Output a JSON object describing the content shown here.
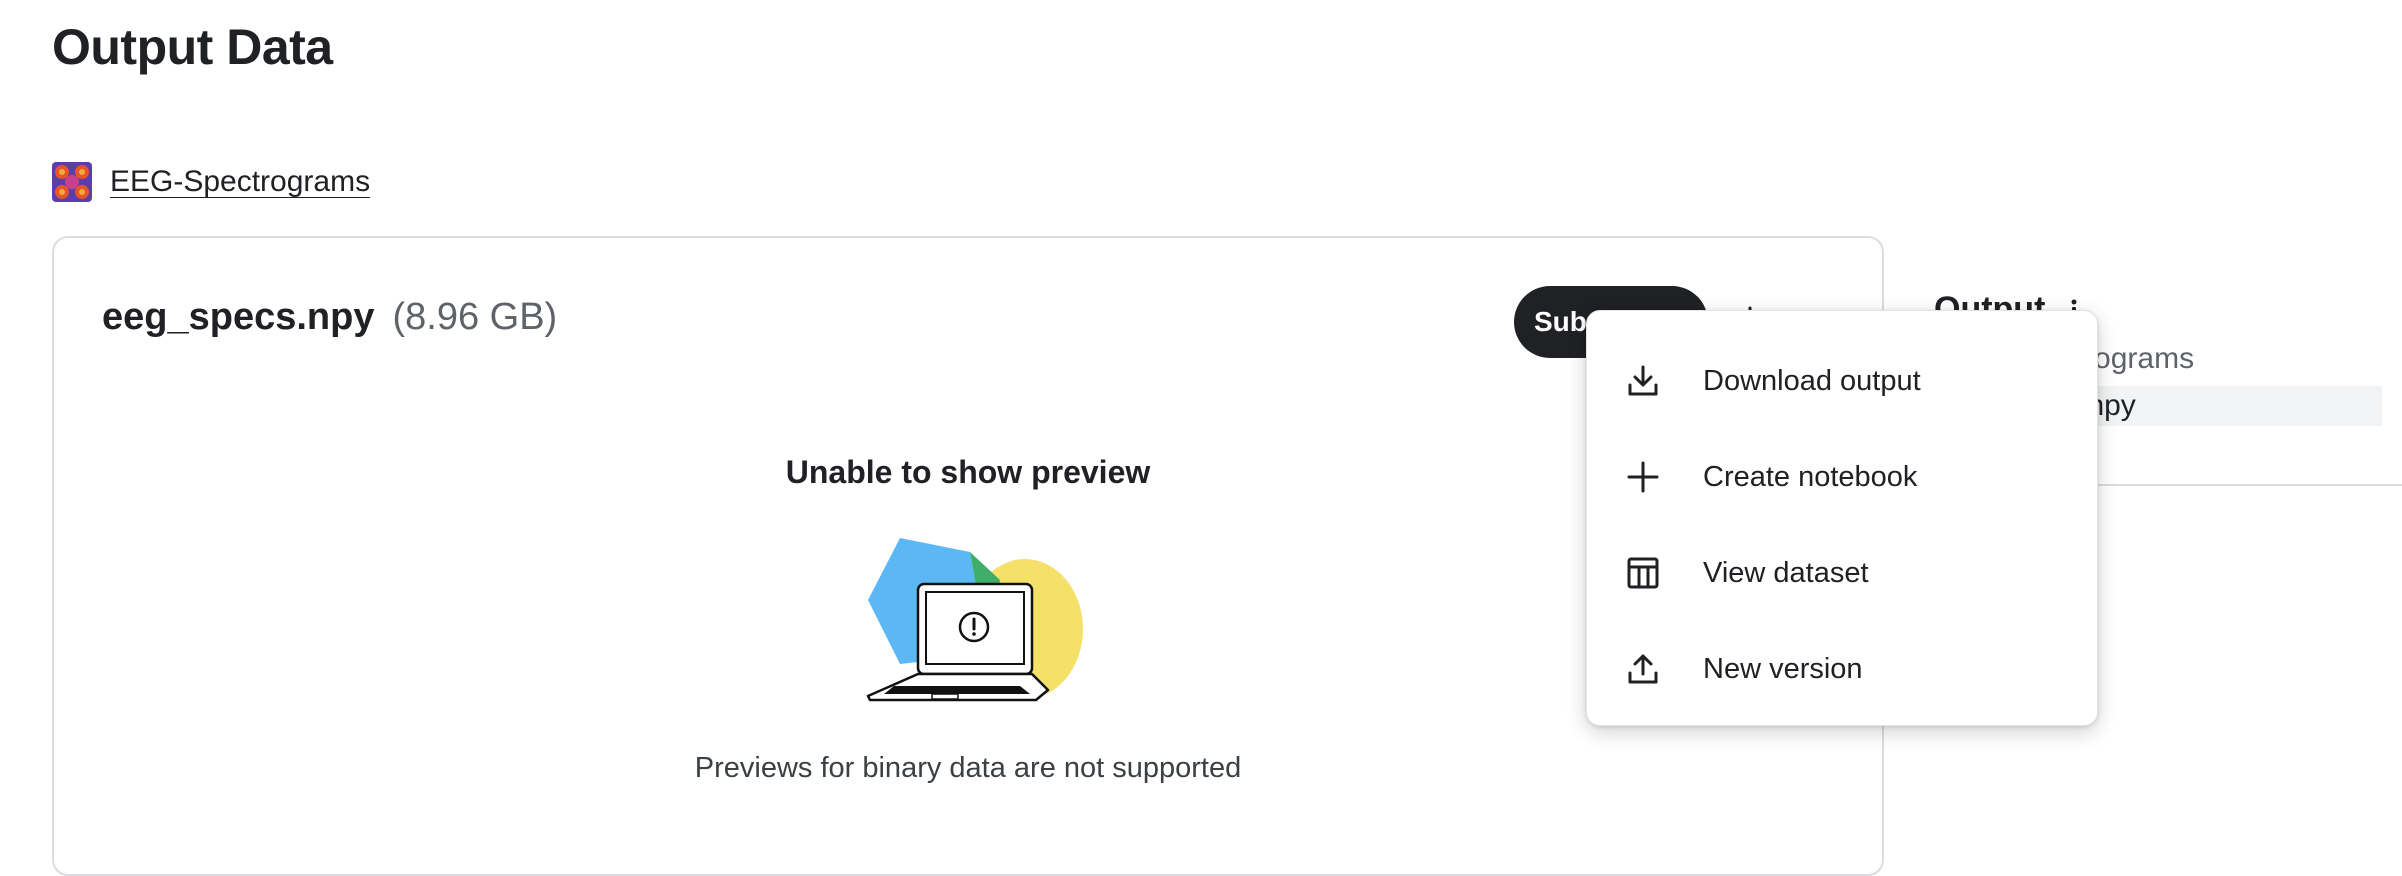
{
  "page": {
    "title": "Output Data"
  },
  "dataset": {
    "name": "EEG-Spectrograms"
  },
  "file": {
    "name": "eeg_specs.npy",
    "size": "(8.96 GB)"
  },
  "actions": {
    "submit_label": "Submit"
  },
  "preview": {
    "title": "Unable to show preview",
    "message": "Previews for binary data are not supported"
  },
  "sidebar": {
    "title": "Output",
    "dataset_item": "EEG-Spectrograms",
    "file_item": "eeg_specs.npy"
  },
  "menu": {
    "items": [
      {
        "label": "Download output",
        "icon": "download-icon"
      },
      {
        "label": "Create notebook",
        "icon": "plus-icon"
      },
      {
        "label": "View dataset",
        "icon": "table-icon"
      },
      {
        "label": "New version",
        "icon": "upload-icon"
      }
    ]
  },
  "colors": {
    "primary_button": "#202124",
    "illustration_blue": "#5bb8f5",
    "illustration_yellow": "#f5e06a",
    "illustration_green": "#3fae68"
  }
}
